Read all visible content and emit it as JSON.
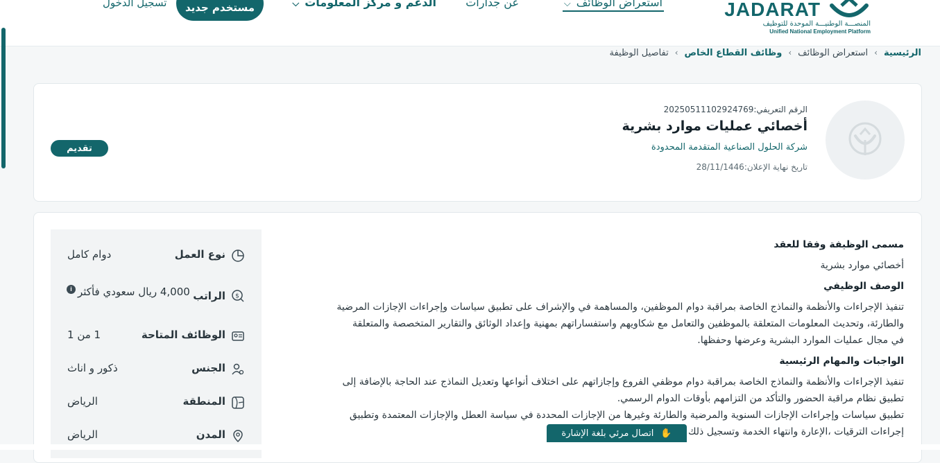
{
  "colors": {
    "primary": "#13666b",
    "background": "#f5f7f8"
  },
  "header": {
    "logo": {
      "brand": "JADARAT",
      "subtitle_ar": "المنصـــة الوطنيـــة الموحدة للتوظيف",
      "subtitle_en": "Unified National Employment Platform"
    },
    "nav": {
      "jobs": "استعراض الوظائف",
      "about": "عن جدارات",
      "support": "الدعم و مركز المعلومات"
    },
    "register_button": "مستخدم جديد",
    "login_link": "تسجيل الدخول"
  },
  "breadcrumb": {
    "home": "الرئيسية",
    "jobs": "استعراض الوظائف",
    "private_jobs": "وظائف القطاع الخاص",
    "current": "تفاصيل الوظيفة"
  },
  "job": {
    "id_line": "الرقم التعريفي:20250511102924769",
    "title": "أخصائي عمليات موارد بشرية",
    "company": "شركة الحلول الصناعية المتقدمة المحدودة",
    "deadline_line": "تاريخ نهاية الإعلان:28/11/1446",
    "apply_button": "تقديم"
  },
  "details": {
    "contract_title_heading": "مسمى الوظيفة وفقا للعقد",
    "contract_title": "أخصائي موارد بشرية",
    "description_heading": "الوصف الوظيفي",
    "description_lines": [
      "تنفيذ الإجراءات والأنظمة والنماذج الخاصة بمراقبة دوام الموظفين، والمساهمة في والإشراف على تطبيق سياسات وإجراءات الإجازات المرضية",
      "والطارئة، وتحديث المعلومات المتعلقة بالموظفين والتعامل مع شكاويهم واستفساراتهم بمهنية وإعداد الوثائق والتقارير المتخصصة والمتعلقة",
      "في مجال عمليات الموارد البشرية وعرضها وحفظها."
    ],
    "duties_heading": "الواجبات والمهام الرئيسية",
    "duties_lines": [
      "تنفيذ الإجراءات والأنظمة والنماذج الخاصة بمراقبة دوام موظفي الفروع وإجازاتهم على اختلاف أنواعها وتعديل النماذج عند الحاجة بالإضافة إلى",
      "تطبيق نظام مراقبة الحضور والتأكد من التزامهم بأوقات الدوام الرسمي.",
      "تطبيق سياسات وإجراءات الإجازات السنوية والمرضية والطارئة وغيرها من الإجازات المحددة في سياسة العطل والإجازات المعتمدة وتطبيق",
      "إجراءات الترقيات ،الإعارة وانتهاء الخدمة وتسجيل ذلك وفق الأنظمة والإجراءات المعتمدة."
    ]
  },
  "sidebar": {
    "work_type": {
      "label": "نوع العمل",
      "value": "دوام كامل"
    },
    "salary": {
      "label": "الراتب",
      "value": "4,000 ريال سعودي فأكثر"
    },
    "openings": {
      "label": "الوظائف المتاحة",
      "value": "1 من 1"
    },
    "gender": {
      "label": "الجنس",
      "value": "ذكور و اناث"
    },
    "region": {
      "label": "المنطقة",
      "value": "الرياض"
    },
    "city": {
      "label": "المدن",
      "value": "الرياض"
    }
  },
  "sign_language_button": "اتصال مرئي بلغة الإشارة"
}
